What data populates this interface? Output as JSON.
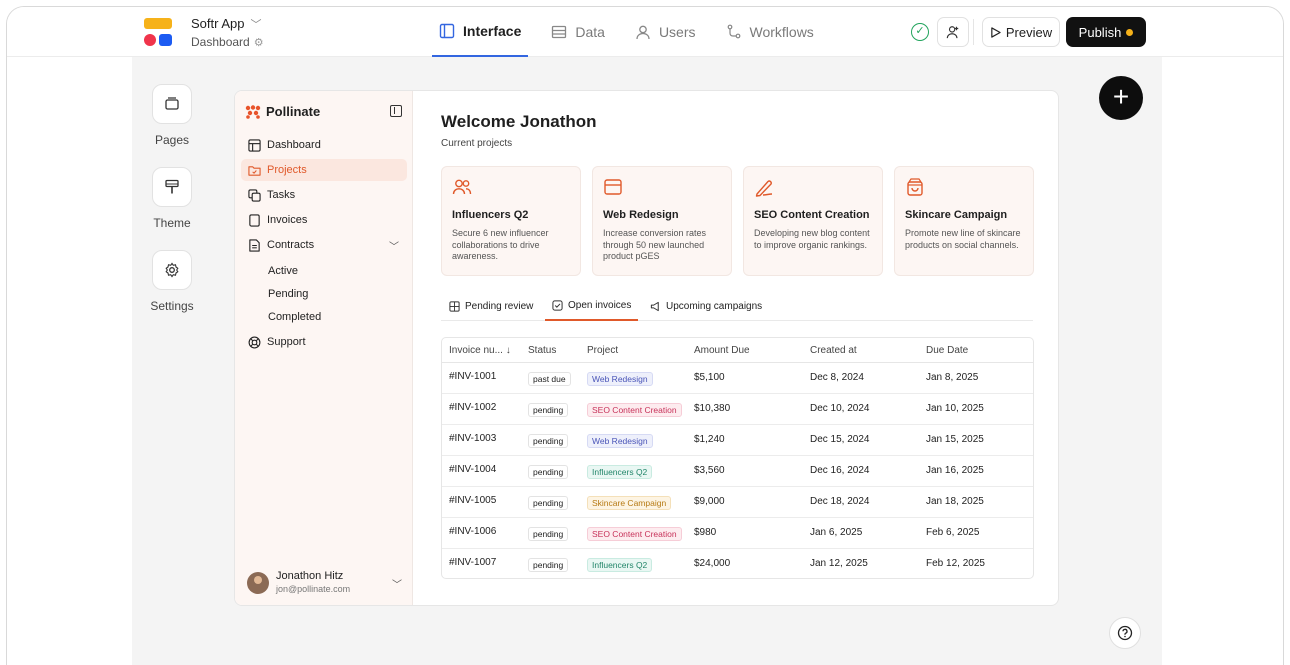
{
  "topbar": {
    "app_name": "Softr App",
    "page_name": "Dashboard",
    "tabs": [
      {
        "label": "Interface",
        "icon": "layout-icon",
        "active": true
      },
      {
        "label": "Data",
        "icon": "table-icon",
        "active": false
      },
      {
        "label": "Users",
        "icon": "user-icon",
        "active": false
      },
      {
        "label": "Workflows",
        "icon": "workflow-icon",
        "active": false
      }
    ],
    "preview_label": "Preview",
    "publish_label": "Publish",
    "colors": {
      "logo_yellow": "#f6b21a",
      "logo_red": "#f0344b",
      "logo_blue": "#1c5bf2",
      "status_green": "#22a45d"
    }
  },
  "rail": {
    "items": [
      {
        "label": "Pages",
        "icon": "pages-icon"
      },
      {
        "label": "Theme",
        "icon": "paint-roller-icon"
      },
      {
        "label": "Settings",
        "icon": "gear-icon"
      }
    ]
  },
  "sidebar": {
    "brand": "Pollinate",
    "accent": "#e0592a",
    "items": [
      {
        "label": "Dashboard",
        "icon": "dashboard-icon"
      },
      {
        "label": "Projects",
        "icon": "folder-icon",
        "active": true
      },
      {
        "label": "Tasks",
        "icon": "tasks-icon"
      },
      {
        "label": "Invoices",
        "icon": "invoice-icon"
      },
      {
        "label": "Contracts",
        "icon": "contract-icon"
      }
    ],
    "contract_sub": [
      "Active",
      "Pending",
      "Completed"
    ],
    "support": "Support",
    "user": {
      "name": "Jonathon Hitz",
      "email": "jon@pollinate.com"
    }
  },
  "main": {
    "welcome": "Welcome Jonathon",
    "subtitle": "Current projects",
    "cards": [
      {
        "title": "Influencers Q2",
        "desc": "Secure 6 new influencer collaborations to drive awareness.",
        "icon": "users-icon"
      },
      {
        "title": "Web Redesign",
        "desc": "Increase conversion rates through 50 new launched product pGES",
        "icon": "browser-icon"
      },
      {
        "title": "SEO Content Creation",
        "desc": "Developing new blog content to improve organic rankings.",
        "icon": "pen-icon"
      },
      {
        "title": "Skincare Campaign",
        "desc": "Promote new line of skincare products on social channels.",
        "icon": "bag-icon"
      }
    ],
    "tabs": [
      {
        "label": "Pending review",
        "icon": "review-icon"
      },
      {
        "label": "Open invoices",
        "icon": "check-square-icon",
        "active": true
      },
      {
        "label": "Upcoming campaigns",
        "icon": "megaphone-icon"
      }
    ],
    "table": {
      "columns": [
        "Invoice nu... ↓",
        "Status",
        "Project",
        "Amount Due",
        "Created at",
        "Due Date"
      ],
      "rows": [
        {
          "invoice": "#INV-1001",
          "status": "past due",
          "project": "Web Redesign",
          "amount": "$5,100",
          "created": "Dec 8, 2024",
          "due": "Jan 8, 2025"
        },
        {
          "invoice": "#INV-1002",
          "status": "pending",
          "project": "SEO Content Creation",
          "amount": "$10,380",
          "created": "Dec 10, 2024",
          "due": "Jan  10, 2025"
        },
        {
          "invoice": "#INV-1003",
          "status": "pending",
          "project": "Web Redesign",
          "amount": "$1,240",
          "created": "Dec 15, 2024",
          "due": "Jan 15, 2025"
        },
        {
          "invoice": "#INV-1004",
          "status": "pending",
          "project": "Influencers Q2",
          "amount": "$3,560",
          "created": "Dec 16, 2024",
          "due": "Jan 16, 2025"
        },
        {
          "invoice": "#INV-1005",
          "status": "pending",
          "project": "Skincare Campaign",
          "amount": "$9,000",
          "created": "Dec 18, 2024",
          "due": "Jan 18, 2025"
        },
        {
          "invoice": "#INV-1006",
          "status": "pending",
          "project": "SEO Content Creation",
          "amount": "$980",
          "created": "Jan 6, 2025",
          "due": "Feb 6, 2025"
        },
        {
          "invoice": "#INV-1007",
          "status": "pending",
          "project": "Influencers Q2",
          "amount": "$24,000",
          "created": "Jan 12, 2025",
          "due": "Feb 12, 2025"
        }
      ]
    }
  }
}
